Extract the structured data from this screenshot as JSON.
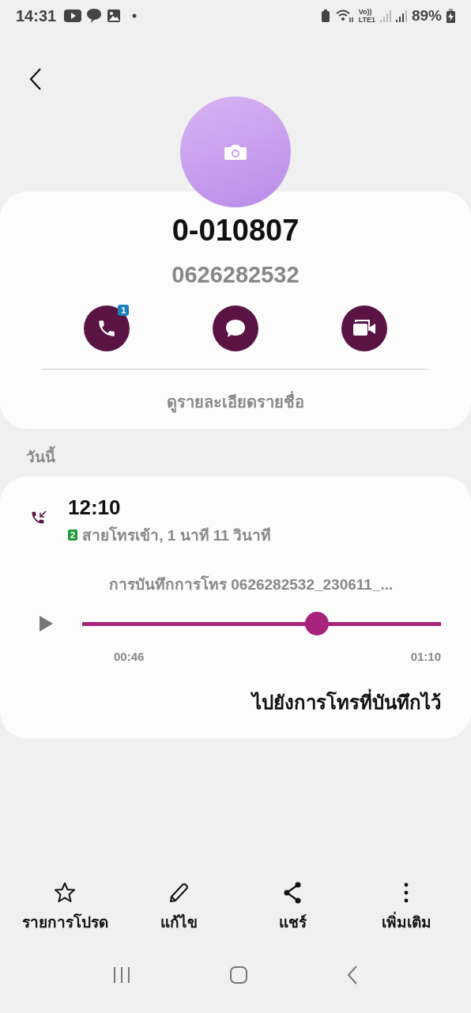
{
  "status_bar": {
    "time": "14:31",
    "volte": "Vo))",
    "network": "LTE1",
    "battery": "89%"
  },
  "contact": {
    "name": "0-010807",
    "number": "0626282532"
  },
  "actions": [
    {
      "kind": "call",
      "badge": "1"
    },
    {
      "kind": "message"
    },
    {
      "kind": "video"
    }
  ],
  "details_link": "ดูรายละเอียดรายชื่อ",
  "section_header": "วันนี้",
  "call_log": {
    "time": "12:10",
    "sim": "2",
    "description": "สายโทรเข้า, 1 นาที 11 วินาที",
    "recording": {
      "title": "การบันทึกการโทร 0626282532_230611_...",
      "level": 0.666,
      "elapsed": "00:46",
      "total": "01:10"
    },
    "go_link": "ไปยังการโทรที่บันทึกไว้"
  },
  "bottom_actions": [
    {
      "kind": "star",
      "label": "รายการโปรด"
    },
    {
      "kind": "edit",
      "label": "แก้ไข"
    },
    {
      "kind": "share",
      "label": "แชร์"
    },
    {
      "kind": "more",
      "label": "เพิ่มเติม"
    }
  ]
}
